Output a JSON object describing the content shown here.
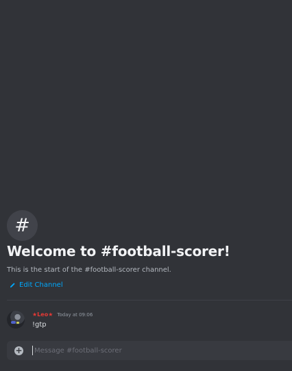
{
  "welcome": {
    "icon": "hashtag-icon",
    "icon_glyph": "#",
    "title": "Welcome to #football-scorer!",
    "subtitle": "This is the start of the #football-scorer channel.",
    "edit_label": "Edit Channel"
  },
  "message": {
    "username": "★Leo★",
    "timestamp": "Today at 09:06",
    "text": "!gtp",
    "username_color": "#e53935"
  },
  "composer": {
    "placeholder": "Message #football-scorer",
    "add_glyph": "+"
  },
  "colors": {
    "background": "#313338",
    "link": "#00a8fc"
  }
}
